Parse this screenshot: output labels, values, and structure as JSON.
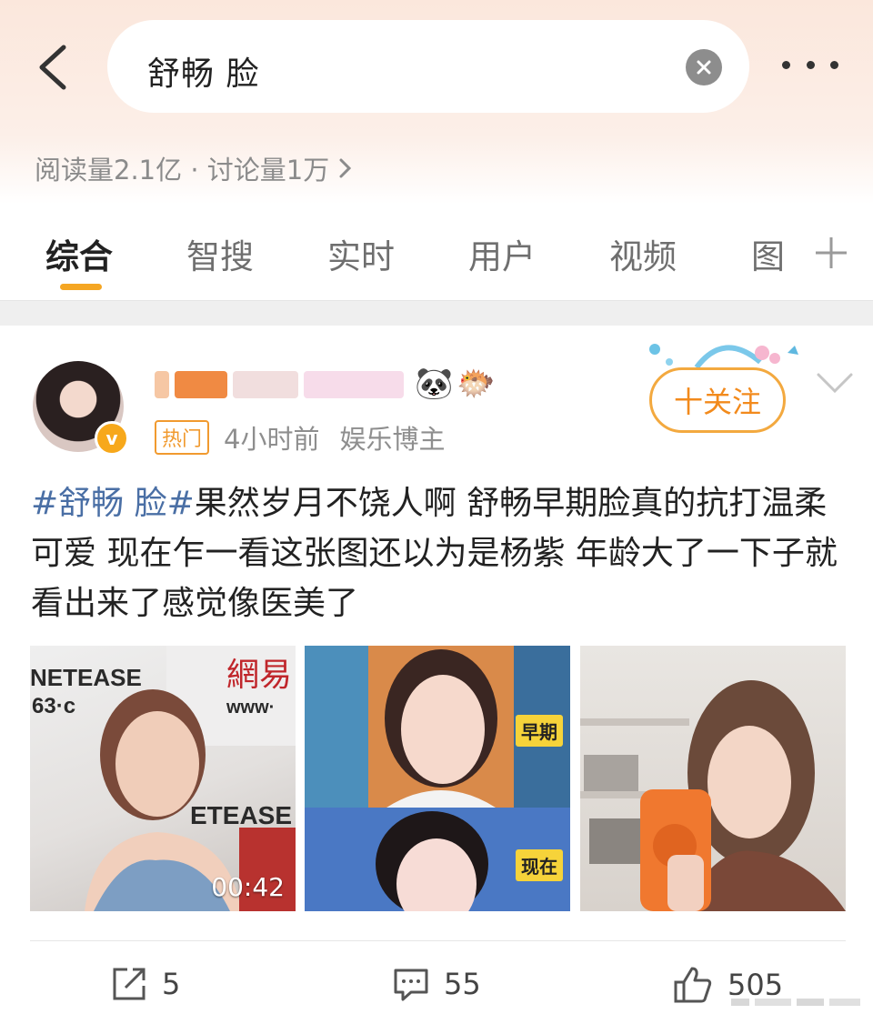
{
  "search": {
    "query": "舒畅 脸"
  },
  "stats": {
    "text": "阅读量2.1亿 · 讨论量1万"
  },
  "tabs": [
    {
      "label": "综合"
    },
    {
      "label": "智搜"
    },
    {
      "label": "实时"
    },
    {
      "label": "用户"
    },
    {
      "label": "视频"
    },
    {
      "label": "图"
    }
  ],
  "post": {
    "hot_badge": "热门",
    "time": "4小时前",
    "role": "娱乐博主",
    "follow_label": "十关注",
    "hashtag": "#舒畅 脸#",
    "body": "果然岁月不饶人啊 舒畅早期脸真的抗打温柔可爱 现在乍一看这张图还以为是杨紫 年龄大了一下子就看出来了感觉像医美了",
    "images": [
      {
        "watermark_top": "NETEASE",
        "watermark_cn": "網易",
        "watermark_url": "www·",
        "watermark_num": "63·c",
        "watermark_bottom": "ETEASE",
        "duration": "00:42"
      },
      {
        "tag_top": "早期",
        "tag_bottom": "现在"
      },
      {}
    ],
    "actions": {
      "repost_count": "5",
      "comment_count": "55",
      "like_count": "505"
    }
  },
  "colors": {
    "accent": "#f5a623",
    "hashtag": "#4a6fa5",
    "follow": "#f28a1c"
  }
}
